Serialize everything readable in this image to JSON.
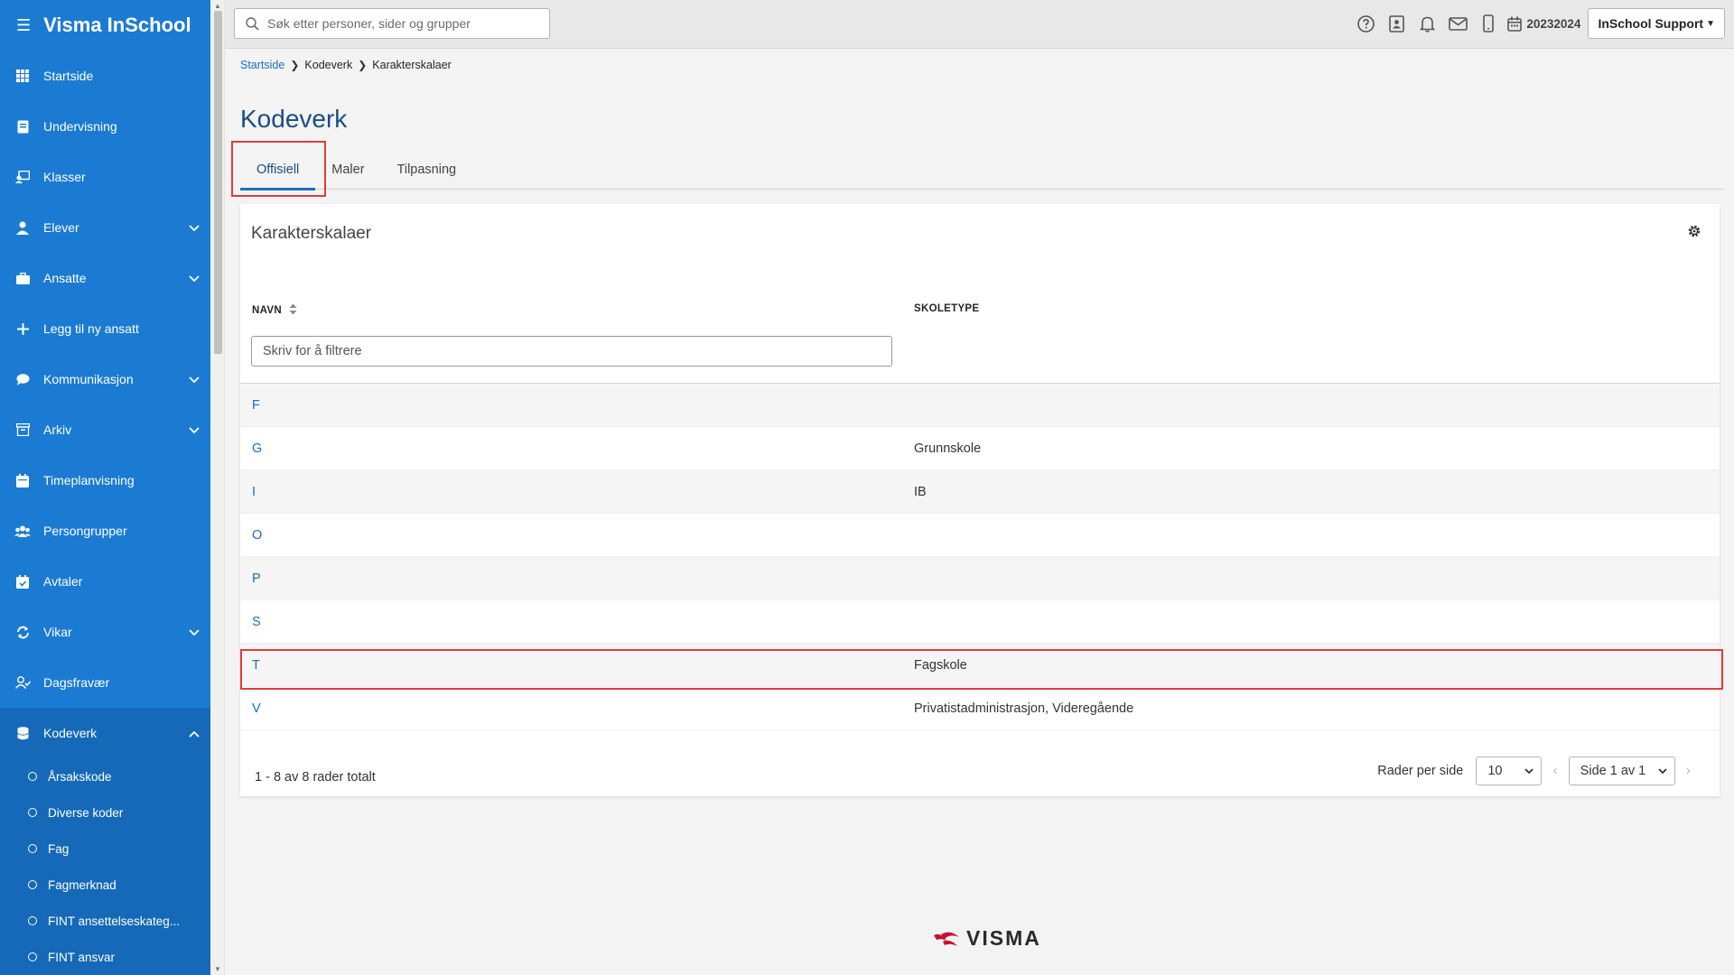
{
  "app": {
    "title": "Visma InSchool"
  },
  "sidebar": {
    "items": [
      {
        "label": "Startside"
      },
      {
        "label": "Undervisning"
      },
      {
        "label": "Klasser"
      },
      {
        "label": "Elever"
      },
      {
        "label": "Ansatte"
      },
      {
        "label": "Legg til ny ansatt"
      },
      {
        "label": "Kommunikasjon"
      },
      {
        "label": "Arkiv"
      },
      {
        "label": "Timeplanvisning"
      },
      {
        "label": "Persongrupper"
      },
      {
        "label": "Avtaler"
      },
      {
        "label": "Vikar"
      },
      {
        "label": "Dagsfravær"
      },
      {
        "label": "Kodeverk"
      }
    ],
    "subitems": [
      {
        "label": "Årsakskode"
      },
      {
        "label": "Diverse koder"
      },
      {
        "label": "Fag"
      },
      {
        "label": "Fagmerknad"
      },
      {
        "label": "FINT ansettelseskateg..."
      },
      {
        "label": "FINT ansvar"
      }
    ]
  },
  "topbar": {
    "search_placeholder": "Søk etter personer, sider og grupper",
    "school_year": "20232024",
    "user_label": "InSchool Support"
  },
  "breadcrumb": {
    "home": "Startside",
    "section": "Kodeverk",
    "current": "Karakterskalaer"
  },
  "page": {
    "title": "Kodeverk",
    "tabs": [
      {
        "label": "Offisiell"
      },
      {
        "label": "Maler"
      },
      {
        "label": "Tilpasning"
      }
    ]
  },
  "card": {
    "title": "Karakterskalaer",
    "col_name": "NAVN",
    "col_type": "SKOLETYPE",
    "filter_placeholder": "Skriv for å filtrere",
    "rows": [
      {
        "name": "F",
        "type": ""
      },
      {
        "name": "G",
        "type": "Grunnskole"
      },
      {
        "name": "I",
        "type": "IB"
      },
      {
        "name": "O",
        "type": ""
      },
      {
        "name": "P",
        "type": ""
      },
      {
        "name": "S",
        "type": ""
      },
      {
        "name": "T",
        "type": "Fagskole"
      },
      {
        "name": "V",
        "type": "Privatistadministrasjon, Videregående"
      }
    ],
    "count_text": "1 - 8 av 8 rader totalt",
    "rows_per_page_label": "Rader per side",
    "rows_per_page_value": "10",
    "page_value": "Side 1 av 1"
  },
  "footer": {
    "logo_text": "VISMA"
  },
  "colors": {
    "sidebar": "#1b7bd3",
    "accent": "#1b6ec2",
    "highlight": "#e03c3c"
  }
}
